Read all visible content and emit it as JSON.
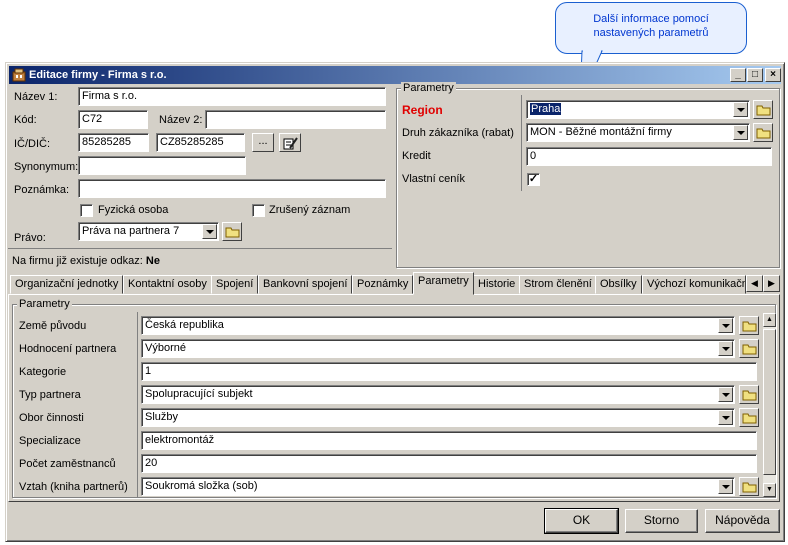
{
  "callout": {
    "line1": "Další informace pomocí",
    "line2": "nastavených parametrů"
  },
  "window": {
    "title": "Editace firmy - Firma s r.o."
  },
  "form": {
    "nazev1_label": "Název 1:",
    "nazev1_value": "Firma s r.o.",
    "kod_label": "Kód:",
    "kod_value": "C72",
    "nazev2_label": "Název 2:",
    "nazev2_value": "",
    "ic_dic_label": "IČ/DIČ:",
    "ic_value": "85285285",
    "dic_value": "CZ85285285",
    "ellipsis": "...",
    "synonymum_label": "Synonymum:",
    "synonymum_value": "",
    "poznamka_label": "Poznámka:",
    "poznamka_value": "",
    "fyzicka_label": "Fyzická osoba",
    "zruseny_label": "Zrušený záznam",
    "pravo_label": "Právo:",
    "pravo_value": "Práva na partnera 7",
    "odkaz_label": "Na firmu již existuje odkaz:",
    "odkaz_value": "Ne"
  },
  "top_params": {
    "title": "Parametry",
    "rows": [
      {
        "label": "Region",
        "value": "Praha",
        "type": "combo"
      },
      {
        "label": "Druh zákazníka (rabat)",
        "value": "MON - Běžné montážní firmy",
        "type": "combo"
      },
      {
        "label": "Kredit",
        "value": "0",
        "type": "text"
      },
      {
        "label": "Vlastní ceník",
        "value": "✓",
        "type": "check"
      }
    ]
  },
  "tabs": [
    "Organizační jednotky",
    "Kontaktní osoby",
    "Spojení",
    "Bankovní spojení",
    "Poznámky",
    "Parametry",
    "Historie",
    "Strom členění",
    "Obsílky",
    "Výchozí komunikačn"
  ],
  "active_tab": "Parametry",
  "params": {
    "title": "Parametry",
    "rows": [
      {
        "label": "Země původu",
        "value": "Česká republika",
        "type": "combo"
      },
      {
        "label": "Hodnocení partnera",
        "value": "Výborné",
        "type": "combo"
      },
      {
        "label": "Kategorie",
        "value": "1",
        "type": "text"
      },
      {
        "label": "Typ partnera",
        "value": "Spolupracující subjekt",
        "type": "combo"
      },
      {
        "label": "Obor činnosti",
        "value": "Služby",
        "type": "combo"
      },
      {
        "label": "Specializace",
        "value": "elektromontáž",
        "type": "text"
      },
      {
        "label": "Počet zaměstnanců",
        "value": "20",
        "type": "text"
      },
      {
        "label": "Vztah (kniha partnerů)",
        "value": "Soukromá složka (sob)",
        "type": "combo"
      }
    ]
  },
  "buttons": {
    "ok": "OK",
    "storno": "Storno",
    "napoveda": "Nápověda"
  },
  "colors": {
    "region_label": "#e00000",
    "title_from": "#0a246a",
    "title_to": "#a6caf0",
    "callout_text": "#0036d0"
  }
}
